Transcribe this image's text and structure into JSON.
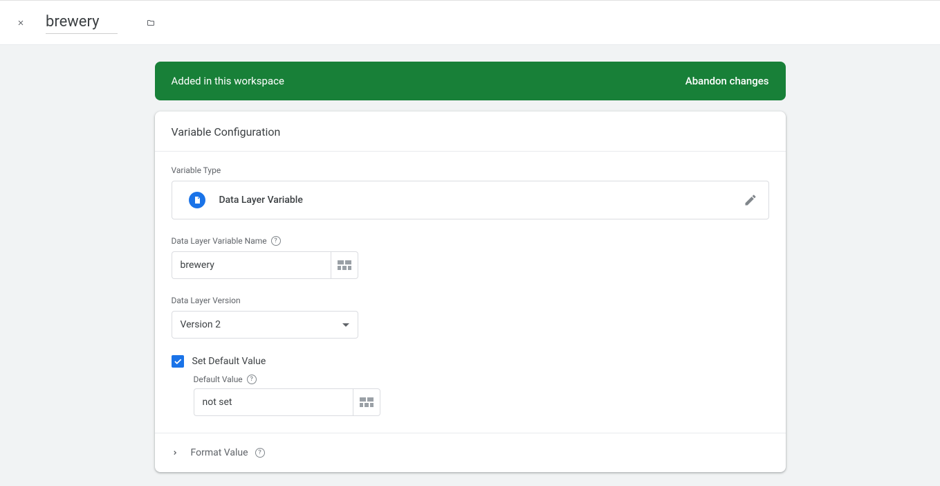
{
  "header": {
    "title_value": "brewery"
  },
  "status": {
    "message": "Added in this workspace",
    "action": "Abandon changes"
  },
  "card": {
    "title": "Variable Configuration",
    "variable_type_label": "Variable Type",
    "variable_type_name": "Data Layer Variable",
    "name_label": "Data Layer Variable Name",
    "name_value": "brewery",
    "version_label": "Data Layer Version",
    "version_value": "Version 2",
    "set_default_checked": true,
    "set_default_label": "Set Default Value",
    "default_label": "Default Value",
    "default_value": "not set",
    "format_label": "Format Value"
  }
}
